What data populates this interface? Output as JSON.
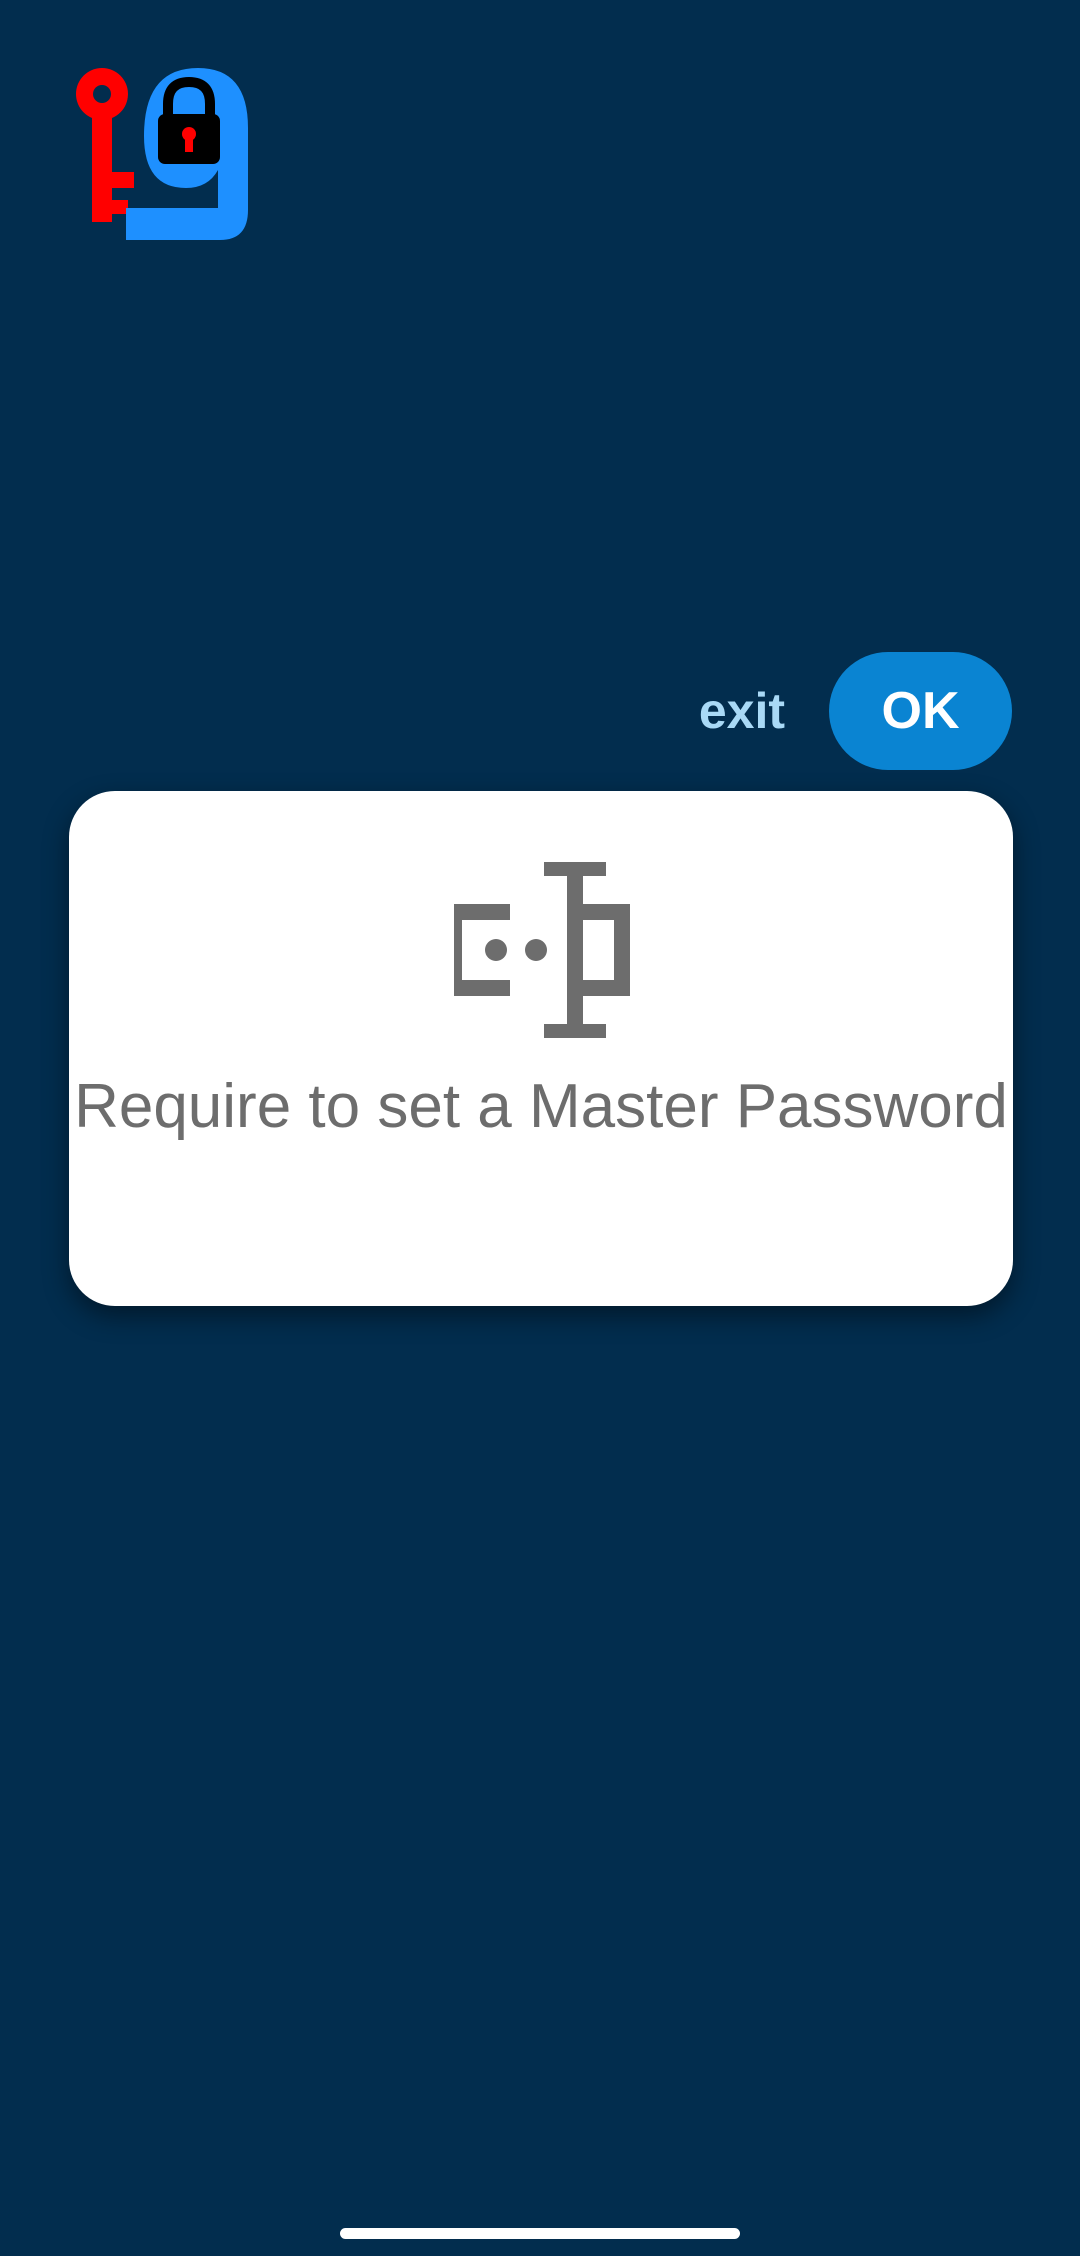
{
  "app": {
    "logo_icon": "key-padlock-logo-icon",
    "colors": {
      "background": "#022d4e",
      "logo_key": "#ff0000",
      "logo_lock_body": "#1e90ff",
      "logo_padlock": "#000000"
    }
  },
  "toolbar": {
    "exit_label": "exit",
    "ok_label": "OK",
    "colors": {
      "exit_text": "#a9d9f6",
      "ok_background": "#0a84d2",
      "ok_text": "#ffffff"
    }
  },
  "dialog": {
    "icon": "password-field-icon",
    "message": "Require to set a Master Password",
    "colors": {
      "card": "#ffffff",
      "text": "#6d6d6d",
      "icon": "#6d6d6d"
    }
  }
}
